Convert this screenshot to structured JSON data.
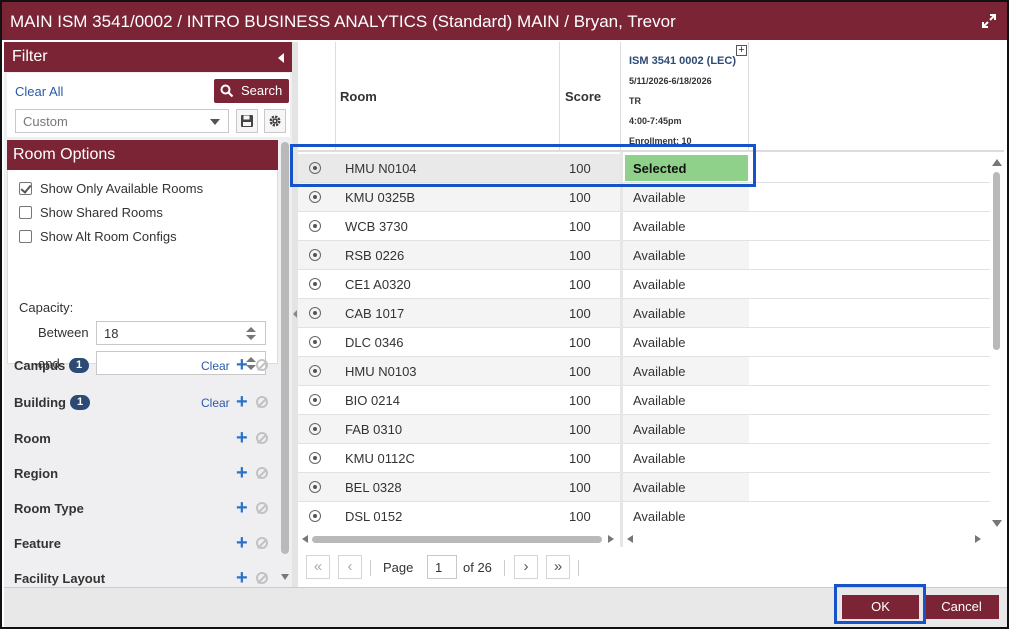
{
  "window": {
    "title": "MAIN ISM 3541/0002 / INTRO BUSINESS ANALYTICS (Standard) MAIN / Bryan, Trevor",
    "expand_icon": "expand-icon"
  },
  "filter": {
    "title": "Filter",
    "clear_all": "Clear All",
    "search_label": "Search",
    "preset_value": "Custom",
    "save_icon": "save-icon",
    "settings_icon": "gear-icon"
  },
  "room_options": {
    "title": "Room Options",
    "checkboxes": [
      {
        "label": "Show Only Available Rooms",
        "checked": true
      },
      {
        "label": "Show Shared Rooms",
        "checked": false
      },
      {
        "label": "Show Alt Room Configs",
        "checked": false
      }
    ],
    "capacity_label": "Capacity:",
    "between_label": "Between",
    "between_value": "18",
    "and_label": "and",
    "and_value": ""
  },
  "facets": [
    {
      "name": "Campus",
      "badge": "1",
      "clear": "Clear"
    },
    {
      "name": "Building",
      "badge": "1",
      "clear": "Clear"
    },
    {
      "name": "Room",
      "badge": "",
      "clear": ""
    },
    {
      "name": "Region",
      "badge": "",
      "clear": ""
    },
    {
      "name": "Room Type",
      "badge": "",
      "clear": ""
    },
    {
      "name": "Feature",
      "badge": "",
      "clear": ""
    },
    {
      "name": "Facility Layout",
      "badge": "",
      "clear": ""
    }
  ],
  "grid": {
    "columns": {
      "room": "Room",
      "score": "Score"
    },
    "section": {
      "code": "ISM 3541 0002 (LEC)",
      "dates": "5/11/2026-6/18/2026",
      "days": "TR",
      "time": "4:00-7:45pm",
      "enrollment": "Enrollment: 10"
    },
    "rows": [
      {
        "room": "HMU N0104",
        "score": "100",
        "status": "Selected"
      },
      {
        "room": "KMU 0325B",
        "score": "100",
        "status": "Available"
      },
      {
        "room": "WCB 3730",
        "score": "100",
        "status": "Available"
      },
      {
        "room": "RSB 0226",
        "score": "100",
        "status": "Available"
      },
      {
        "room": "CE1 A0320",
        "score": "100",
        "status": "Available"
      },
      {
        "room": "CAB 1017",
        "score": "100",
        "status": "Available"
      },
      {
        "room": "DLC 0346",
        "score": "100",
        "status": "Available"
      },
      {
        "room": "HMU N0103",
        "score": "100",
        "status": "Available"
      },
      {
        "room": "BIO 0214",
        "score": "100",
        "status": "Available"
      },
      {
        "room": "FAB 0310",
        "score": "100",
        "status": "Available"
      },
      {
        "room": "KMU 0112C",
        "score": "100",
        "status": "Available"
      },
      {
        "room": "BEL 0328",
        "score": "100",
        "status": "Available"
      },
      {
        "room": "DSL 0152",
        "score": "100",
        "status": "Available"
      }
    ]
  },
  "pager": {
    "page_label": "Page",
    "page_value": "1",
    "of_label": "of 26"
  },
  "footer": {
    "ok_label": "OK",
    "cancel_label": "Cancel"
  },
  "colors": {
    "brand": "#7b2436",
    "selected_cell": "#8fd18a",
    "highlight": "#1652c8",
    "badge": "#2c4a73",
    "link": "#2a5aa8"
  }
}
